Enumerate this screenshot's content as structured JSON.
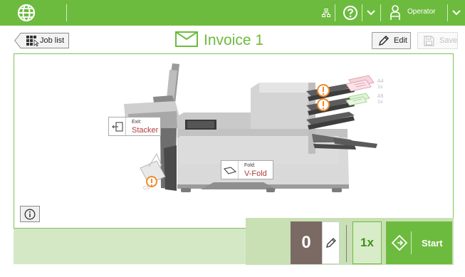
{
  "topbar": {
    "language_icon": "globe-icon",
    "network_icon": "network-icon",
    "help_icon": "help-icon",
    "operator_label": "Operator"
  },
  "titlerow": {
    "job_list_label": "Job list",
    "title": "Invoice 1",
    "edit_label": "Edit",
    "save_label": "Save"
  },
  "machine": {
    "exit_key": "Exit:",
    "exit_value": "Stacker",
    "fold_key": "Fold:",
    "fold_value": "V-Fold",
    "tray1_size": "A4",
    "tray1_count": "1x",
    "tray2_size": "A5",
    "tray2_count": "1x",
    "envelope_size": "C5"
  },
  "bottom": {
    "counter": "0",
    "multiplier": "1x",
    "start_label": "Start"
  },
  "colors": {
    "accent": "#6dbb3e",
    "warning": "#f28a2b",
    "value_red": "#b23a3a"
  }
}
